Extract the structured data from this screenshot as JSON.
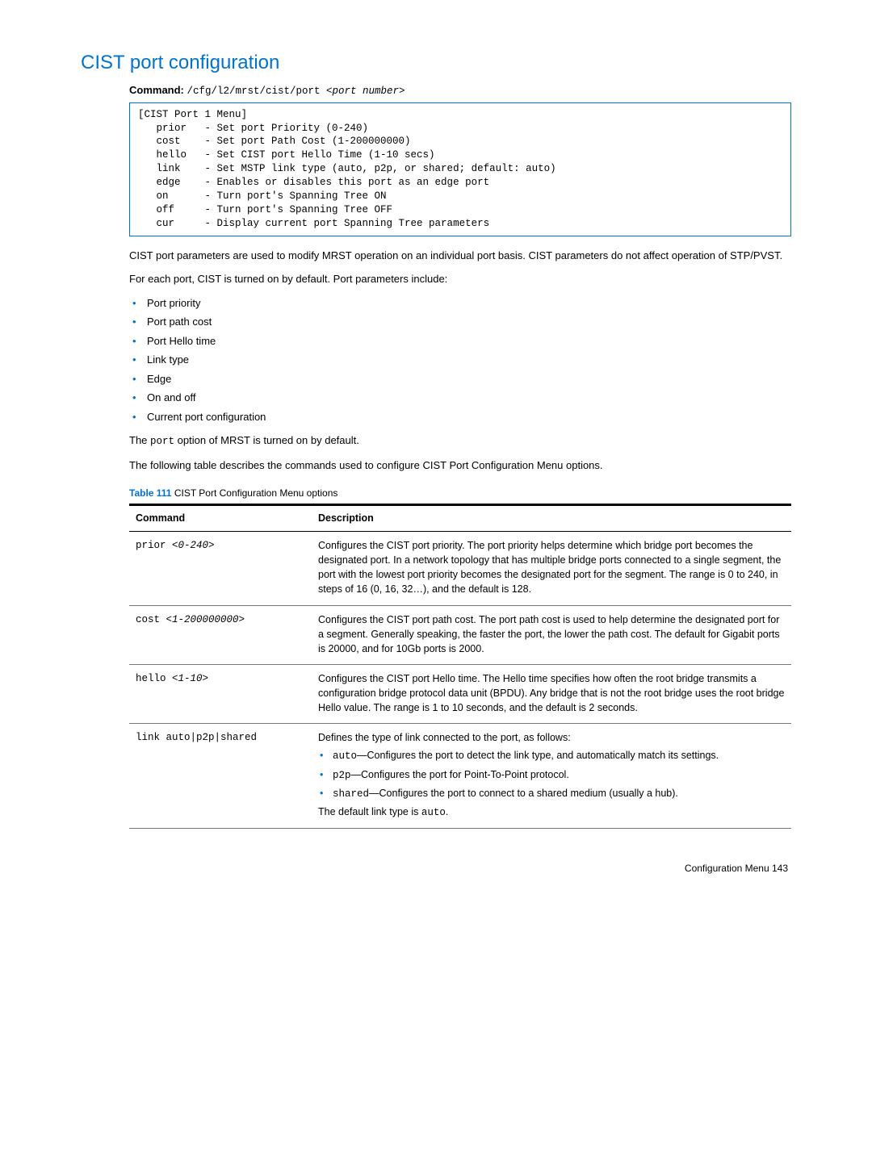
{
  "title": "CIST port configuration",
  "command_label": "Command:",
  "command_text": "/cfg/l2/mrst/cist/port ",
  "command_arg": "<port number>",
  "code_block": "[CIST Port 1 Menu]\n   prior   - Set port Priority (0-240)\n   cost    - Set port Path Cost (1-200000000)\n   hello   - Set CIST port Hello Time (1-10 secs)\n   link    - Set MSTP link type (auto, p2p, or shared; default: auto)\n   edge    - Enables or disables this port as an edge port\n   on      - Turn port's Spanning Tree ON\n   off     - Turn port's Spanning Tree OFF\n   cur     - Display current port Spanning Tree parameters",
  "para1": "CIST port parameters are used to modify MRST operation on an individual port basis. CIST parameters do not affect operation of STP/PVST.",
  "para2": "For each port, CIST is turned on by default. Port parameters include:",
  "bullets": [
    "Port priority",
    "Port path cost",
    "Port Hello time",
    "Link type",
    "Edge",
    "On and off",
    "Current port configuration"
  ],
  "para3_pre": "The ",
  "para3_mono": "port",
  "para3_post": " option of MRST is turned on by default.",
  "para4": "The following table describes the commands used to configure CIST Port Configuration Menu options.",
  "table_label": "Table 111",
  "table_caption": " CIST Port Configuration Menu options",
  "th_command": "Command",
  "th_desc": "Description",
  "rows": {
    "r1": {
      "cmd_pre": "prior ",
      "cmd_arg": "<0-240>",
      "desc": "Configures the CIST port priority. The port priority helps determine which bridge port becomes the designated port. In a network topology that has multiple bridge ports connected to a single segment, the port with the lowest port priority becomes the designated port for the segment. The range is 0 to 240, in steps of 16 (0, 16, 32…), and the default is 128."
    },
    "r2": {
      "cmd_pre": "cost ",
      "cmd_arg": "<1-200000000>",
      "desc": "Configures the CIST port path cost. The port path cost is used to help determine the designated port for a segment. Generally speaking, the faster the port, the lower the path cost. The default for Gigabit ports is 20000, and for 10Gb ports is 2000."
    },
    "r3": {
      "cmd_pre": "hello ",
      "cmd_arg": "<1-10>",
      "desc": "Configures the CIST port Hello time. The Hello time specifies how often the root bridge transmits a configuration bridge protocol data unit (BPDU). Any bridge that is not the root bridge uses the root bridge Hello value. The range is 1 to 10 seconds, and the default is 2 seconds."
    },
    "r4": {
      "cmd": "link auto|p2p|shared",
      "desc_intro": "Defines the type of link connected to the port, as follows:",
      "b1_code": "auto",
      "b1_text": "—Configures the port to detect the link type, and automatically match its settings.",
      "b2_code": "p2p",
      "b2_text": "—Configures the port for Point-To-Point protocol.",
      "b3_code": "shared",
      "b3_text": "—Configures the port to connect to a shared medium (usually a hub).",
      "tail_pre": "The default link type is ",
      "tail_code": "auto",
      "tail_post": "."
    }
  },
  "footer": "Configuration Menu   143"
}
